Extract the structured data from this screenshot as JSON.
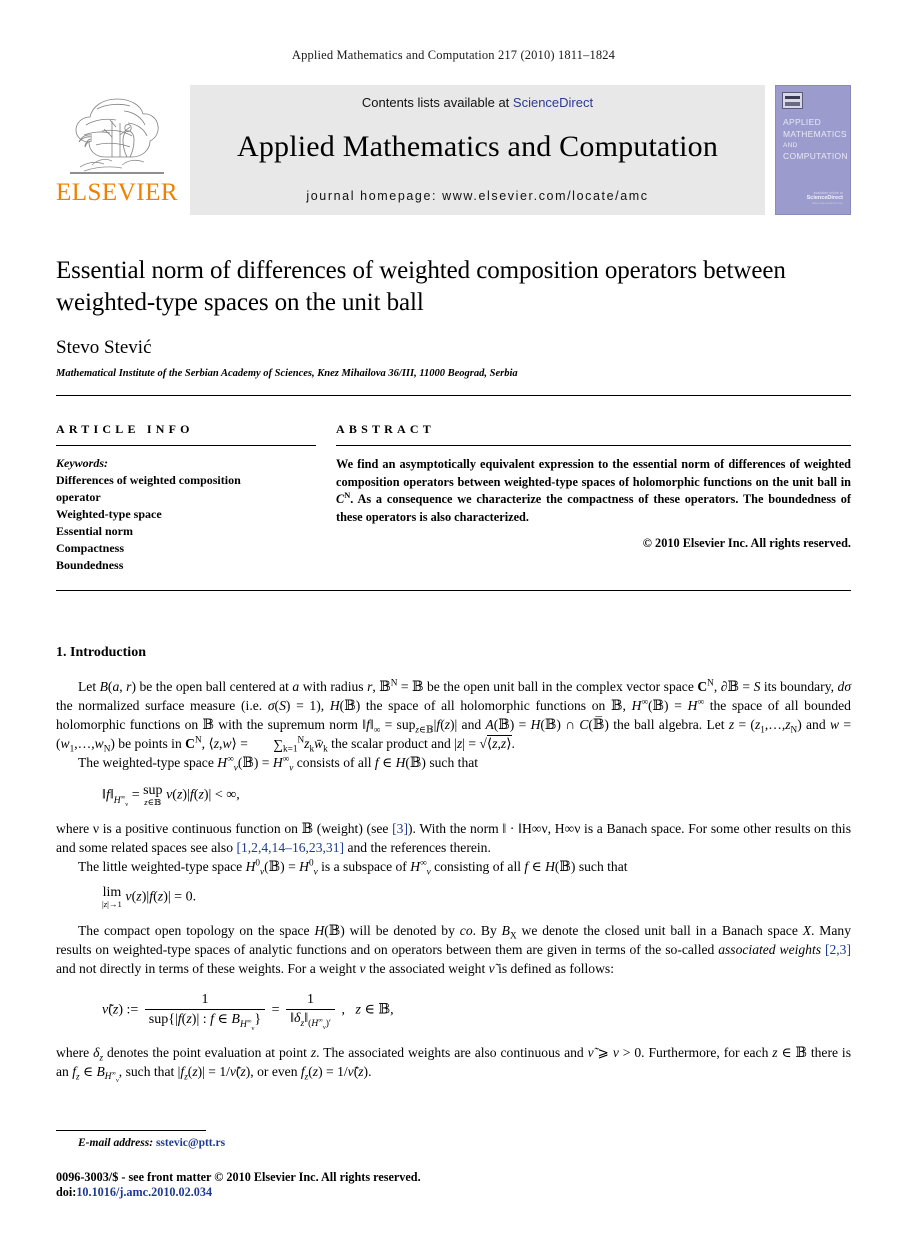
{
  "running_head": "Applied Mathematics and Computation 217 (2010) 1811–1824",
  "masthead": {
    "publisher_wordmark": "ELSEVIER",
    "contents_prefix": "Contents lists available at ",
    "contents_link": "ScienceDirect",
    "journal_name": "Applied Mathematics and Computation",
    "homepage": "journal homepage: www.elsevier.com/locate/amc",
    "cover": {
      "line1": "APPLIED",
      "line2": "MATHEMATICS",
      "line3": "AND",
      "line4": "COMPUTATION",
      "sd_small": "available online at",
      "sd_brand": "ScienceDirect",
      "sd_url": "www.sciencedirect.com",
      "bg_color": "#9b9bce"
    }
  },
  "article": {
    "title": "Essential norm of differences of weighted composition operators between weighted-type spaces on the unit ball",
    "author": "Stevo Stević",
    "affiliation": "Mathematical Institute of the Serbian Academy of Sciences, Knez Mihailova 36/III, 11000 Beograd, Serbia"
  },
  "article_info": {
    "heading": "ARTICLE INFO",
    "keywords_label": "Keywords:",
    "keywords": [
      "Differences of weighted composition",
      "operator",
      "Weighted-type space",
      "Essential norm",
      "Compactness",
      "Boundedness"
    ]
  },
  "abstract": {
    "heading": "ABSTRACT",
    "text_part1": "We find an asymptotically equivalent expression to the essential norm of differences of weighted composition operators between weighted-type spaces of holomorphic functions on the unit ball in ",
    "text_cn": "C",
    "text_cn_sup": "N",
    "text_part2": ". As a consequence we characterize the compactness of these operators. The boundedness of these operators is also characterized.",
    "copyright": "© 2010 Elsevier Inc. All rights reserved."
  },
  "introduction": {
    "heading": "1. Introduction",
    "p1_a": "Let ",
    "p1_b": "B(a, r)",
    "p1_c": " be the open ball centered at ",
    "p1_d": "a",
    "p1_e": " with radius ",
    "p1_f": "r",
    "p1_g": ", 𝔹",
    "p1_full": "Let B(a, r) be the open ball centered at a with radius r, 𝔹N = 𝔹 be the open unit ball in the complex vector space CN, ∂𝔹 = S its boundary, dσ the normalized surface measure (i.e. σ(S) = 1), H(𝔹) the space of all holomorphic functions on 𝔹, H∞(𝔹) = H∞ the space of all bounded holomorphic functions on 𝔹 with the supremum norm ‖f‖∞ = supz∈𝔹|f(z)| and A(𝔹) = H(𝔹) ∩ C(̅𝔹) the ball algebra. Let z = (z1,…,zN) and w = (w1,…,wN) be points in CN, ⟨z, w⟩ = ∑k=1N zk w̄k the scalar product and |z| = √⟨z, z⟩.",
    "p2_full": "The weighted-type space H∞ν(𝔹) = H∞ν consists of all f ∈ H(𝔹) such that",
    "eq1": "‖f‖H∞ν = sup z∈𝔹 ν(z)|f(z)| < ∞,",
    "p3_a": "where ν is a positive continuous function on 𝔹 (weight) (see ",
    "p3_cite1": "[3]",
    "p3_b": "). With the norm ‖ · ‖H∞ν, H∞ν is a Banach space. For some other results on this and some related spaces see also ",
    "p3_cite2": "[1,2,4,14–16,23,31]",
    "p3_c": " and the references therein.",
    "p4_full": "The little weighted-type space H0ν(𝔹) = H0ν is a subspace of H∞ν consisting of all f ∈ H(𝔹) such that",
    "eq2": "lim |z|→1 ν(z)|f(z)| = 0.",
    "p5_a": "The compact open topology on the space H(𝔹) will be denoted by co. By B",
    "p5_sub": "X",
    "p5_b": " we denote the closed unit ball in a Banach space X. Many results on weighted-type spaces of analytic functions and on operators between them are given in terms of the so-called ",
    "p5_italic": "associated weights",
    "p5_c": " ",
    "p5_cite": "[2,3]",
    "p5_d": " and not directly in terms of these weights. For a weight ν the associated weight ṽ is defined as follows:",
    "eq3_lhs": "ṽ(z) :=",
    "eq3_num1": "1",
    "eq3_den1": "sup{|f(z)| : f ∈ BH∞ν}",
    "eq3_eq": "=",
    "eq3_num2": "1",
    "eq3_den2": "‖δz‖(H∞ν)′",
    "eq3_cond": ",   z ∈ 𝔹,",
    "p6_a": "where δ",
    "p6_sub": "z",
    "p6_b": " denotes the point evaluation at point z. The associated weights are also continuous and ṽ ⩾ ν > 0. Furthermore, for each z ∈ 𝔹 there is an f",
    "p6_c": " ∈ BH∞ν, such that |fz(z)| = 1/ṽ(z), or even fz(z) = 1/ṽ(z)."
  },
  "footer": {
    "email_label": "E-mail address:",
    "email": "sstevic@ptt.rs",
    "issn_line": "0096-3003/$ - see front matter © 2010 Elsevier Inc. All rights reserved.",
    "doi_label": "doi:",
    "doi": "10.1016/j.amc.2010.02.034"
  }
}
